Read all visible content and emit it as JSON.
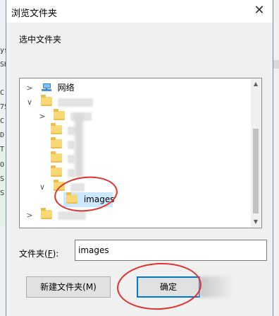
{
  "window": {
    "title": "浏览文件夹",
    "close_glyph": "✕"
  },
  "instruction": "选中文件夹",
  "tree": {
    "network_label": "网络",
    "selected_folder": "images"
  },
  "folder_field": {
    "label": "文件夹(",
    "accel": "F",
    "label_end": "):",
    "value": "images"
  },
  "buttons": {
    "new_folder": "新建文件夹(M)",
    "ok": "确定"
  },
  "icons": {
    "network": "network-icon",
    "folder": "folder-icon",
    "expand": "chevron-right-icon",
    "collapse": "chevron-down-icon"
  },
  "colors": {
    "selection": "#cce8ff",
    "annotation": "#e0312d",
    "default_button_border": "#0078d7"
  },
  "background_fragments": [
    "ys",
    "SH",
    "C",
    "7S",
    "C",
    "D",
    "T",
    "O",
    "S",
    "S"
  ]
}
